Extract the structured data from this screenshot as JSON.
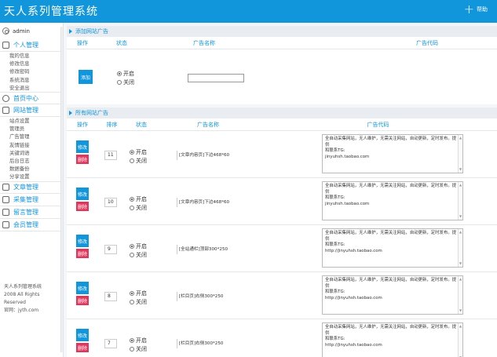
{
  "app": {
    "title": "天人系列管理系统",
    "help_label": "帮助"
  },
  "sidebar": {
    "user": "admin",
    "sections": [
      {
        "label": "个人管理",
        "items": [
          "我的信息",
          "修改信息",
          "修改密码",
          "系统消息",
          "安全退出"
        ]
      },
      {
        "label": "首页中心",
        "items": []
      },
      {
        "label": "网站管理",
        "items": [
          "站点设置",
          "管理员",
          "广告管理",
          "友情链接",
          "关键词语",
          "后台日志",
          "数据备份",
          "分享设置"
        ]
      },
      {
        "label": "文章管理",
        "items": []
      },
      {
        "label": "采集管理",
        "items": []
      },
      {
        "label": "留言管理",
        "items": []
      },
      {
        "label": "会员管理",
        "items": []
      }
    ],
    "footer": [
      "天人系列管理系统",
      "2008 All Rights Reserved",
      "官网：jyth.com"
    ]
  },
  "add_panel": {
    "title": "添加网站广告",
    "headers": [
      "操作",
      "状态",
      "广告名称",
      "广告代码"
    ],
    "add_button": "添加",
    "status_options": [
      "开启",
      "关闭"
    ],
    "name_value": ""
  },
  "list_panel": {
    "title": "所有网站广告",
    "headers": [
      "操作",
      "排序",
      "状态",
      "广告名称",
      "广告代码"
    ],
    "edit_label": "修改",
    "delete_label": "删除",
    "status_options": [
      "开启",
      "关闭"
    ],
    "rows": [
      {
        "sort": "11",
        "name": "[文章内容页]下边468*60",
        "code": [
          "全自动采集网站，无人维护，无需关注网站，自动更新，定时发布。提供",
          "和联系TG:",
          "jinyuhsh.taobao.com"
        ]
      },
      {
        "sort": "10",
        "name": "[文章内容页]下边468*60",
        "code": [
          "全自动采集网站，无人维护，无需关注网站，自动更新，定时发布。提供",
          "和联系TG:",
          "jinyuhsh.taobao.com"
        ]
      },
      {
        "sort": "9",
        "name": "[全站通栏]顶部300*250",
        "code": [
          "全自动采集网站，无人维护，无需关注网站，自动更新，定时发布。提供",
          "和联系TG:",
          "http://jinyuhsh.taobao.com"
        ]
      },
      {
        "sort": "8",
        "name": "[栏目页]右侧300*250",
        "code": [
          "全自动采集网站，无人维护，无需关注网站，自动更新，定时发布。提供",
          "和联系TG:",
          "http://jinyuhsh.taobao.com"
        ]
      },
      {
        "sort": "7",
        "name": "[栏目页]右侧300*250",
        "code": [
          "全自动采集网站，无人维护，无需关注网站，自动更新，定时发布。提供",
          "和联系TG:",
          "http://jinyuhsh.taobao.com"
        ]
      }
    ]
  }
}
